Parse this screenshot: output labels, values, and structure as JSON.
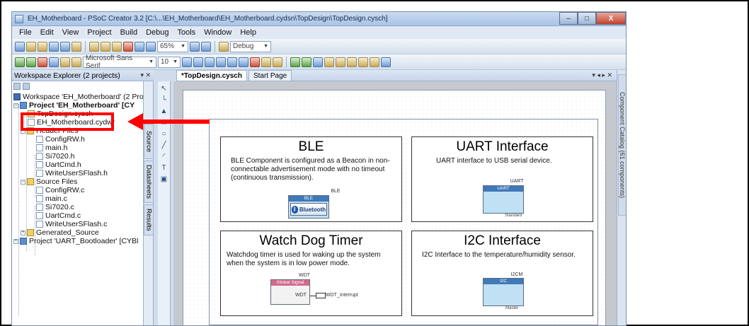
{
  "window": {
    "title": "EH_Motherboard - PSoC Creator 3.2  [C:\\...\\EH_Motherboard\\EH_Motherboard.cydsn\\TopDesign\\TopDesign.cysch]",
    "minimize": "–",
    "maximize": "□",
    "close": "X"
  },
  "menu": [
    "File",
    "Edit",
    "View",
    "Project",
    "Build",
    "Debug",
    "Tools",
    "Window",
    "Help"
  ],
  "toolbar": {
    "zoom": "65%",
    "config": "Debug",
    "font": "Microsoft Sans Serif",
    "font_size": "10"
  },
  "workspace": {
    "header": "Workspace Explorer (2 projects)",
    "pin": "▾ ✕",
    "tree": [
      {
        "label": "Workspace 'EH_Motherboard' (2 Pro",
        "icon": "workspace"
      },
      {
        "label": "Project 'EH_Motherboard' [CY",
        "icon": "project"
      },
      {
        "label": "TopDesign.cysch",
        "icon": "schematic"
      },
      {
        "label": "EH_Motherboard.cydwr",
        "icon": "file"
      },
      {
        "label": "Header Files",
        "icon": "folder"
      },
      {
        "label": "ConfigRW.h",
        "icon": "file"
      },
      {
        "label": "main.h",
        "icon": "file"
      },
      {
        "label": "Si7020.h",
        "icon": "file"
      },
      {
        "label": "UartCmd.h",
        "icon": "file"
      },
      {
        "label": "WriteUserSFlash.h",
        "icon": "file"
      },
      {
        "label": "Source Files",
        "icon": "folder"
      },
      {
        "label": "ConfigRW.c",
        "icon": "file"
      },
      {
        "label": "main.c",
        "icon": "file"
      },
      {
        "label": "Si7020.c",
        "icon": "file"
      },
      {
        "label": "UartCmd.c",
        "icon": "file"
      },
      {
        "label": "WriteUserSFlash.c",
        "icon": "file"
      },
      {
        "label": "Generated_Source",
        "icon": "folder"
      },
      {
        "label": "Project 'UART_Bootloader' [CYBl",
        "icon": "project"
      }
    ],
    "side_tabs": [
      "Source",
      "Datasheets",
      "Results"
    ]
  },
  "tabs": [
    {
      "label": "*TopDesign.cysch",
      "active": true
    },
    {
      "label": "Start Page",
      "active": false
    }
  ],
  "tab_controls": "▾ ◂ ▸ ✕",
  "component_catalog": "Component Catalog (61 components)",
  "blocks": {
    "ble": {
      "title": "BLE",
      "desc": "BLE Component is configured as a Beacon in non-connectable advertisement mode with no timeout (continuous transmission).",
      "comp_label": "BLE",
      "comp_header": "BLE",
      "logo": "Bluetooth",
      "logo_sub": "SMART"
    },
    "uart": {
      "title": "UART Interface",
      "desc": "UART interface to USB serial device.",
      "comp_label": "UART",
      "comp_header": "UART",
      "comp_foot": "Standard"
    },
    "wdt": {
      "title": "Watch Dog Timer",
      "desc": "Watchdog timer is used for waking up the system when the system is in low power mode.",
      "comp_label": "WDT",
      "comp_header": "Global Signal",
      "pin": "WDT",
      "net": "WDT_Interrupt"
    },
    "i2c": {
      "title": "I2C Interface",
      "desc": "I2C Interface to the temperature/humidity sensor.",
      "comp_label": "I2CM",
      "comp_header": "I2C",
      "comp_foot": "Master"
    }
  }
}
